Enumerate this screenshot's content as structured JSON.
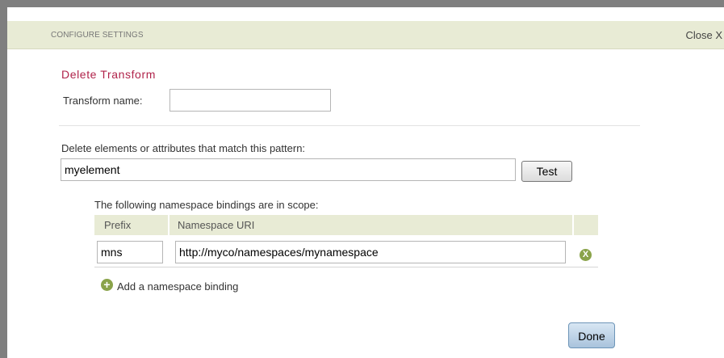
{
  "header": {
    "title": "CONFIGURE SETTINGS",
    "close_label": "Close X"
  },
  "form": {
    "section_title": "Delete Transform",
    "transform_name_label": "Transform name:",
    "transform_name_value": "",
    "pattern_label": "Delete elements or attributes that match this pattern:",
    "pattern_value": "myelement",
    "test_button": "Test"
  },
  "namespaces": {
    "intro": "The following namespace bindings are in scope:",
    "columns": [
      "Prefix",
      "Namespace URI"
    ],
    "rows": [
      {
        "prefix": "mns",
        "uri": "http://myco/namespaces/mynamespace",
        "remove_label": "X"
      }
    ],
    "add_icon": "+",
    "add_label": "Add a namespace binding"
  },
  "footer": {
    "done_button": "Done"
  },
  "colors": {
    "header_bg": "#e8ebd5",
    "title_accent": "#b0234a",
    "icon_green": "#8aa34a",
    "done_blue": "#a9c3dc"
  }
}
